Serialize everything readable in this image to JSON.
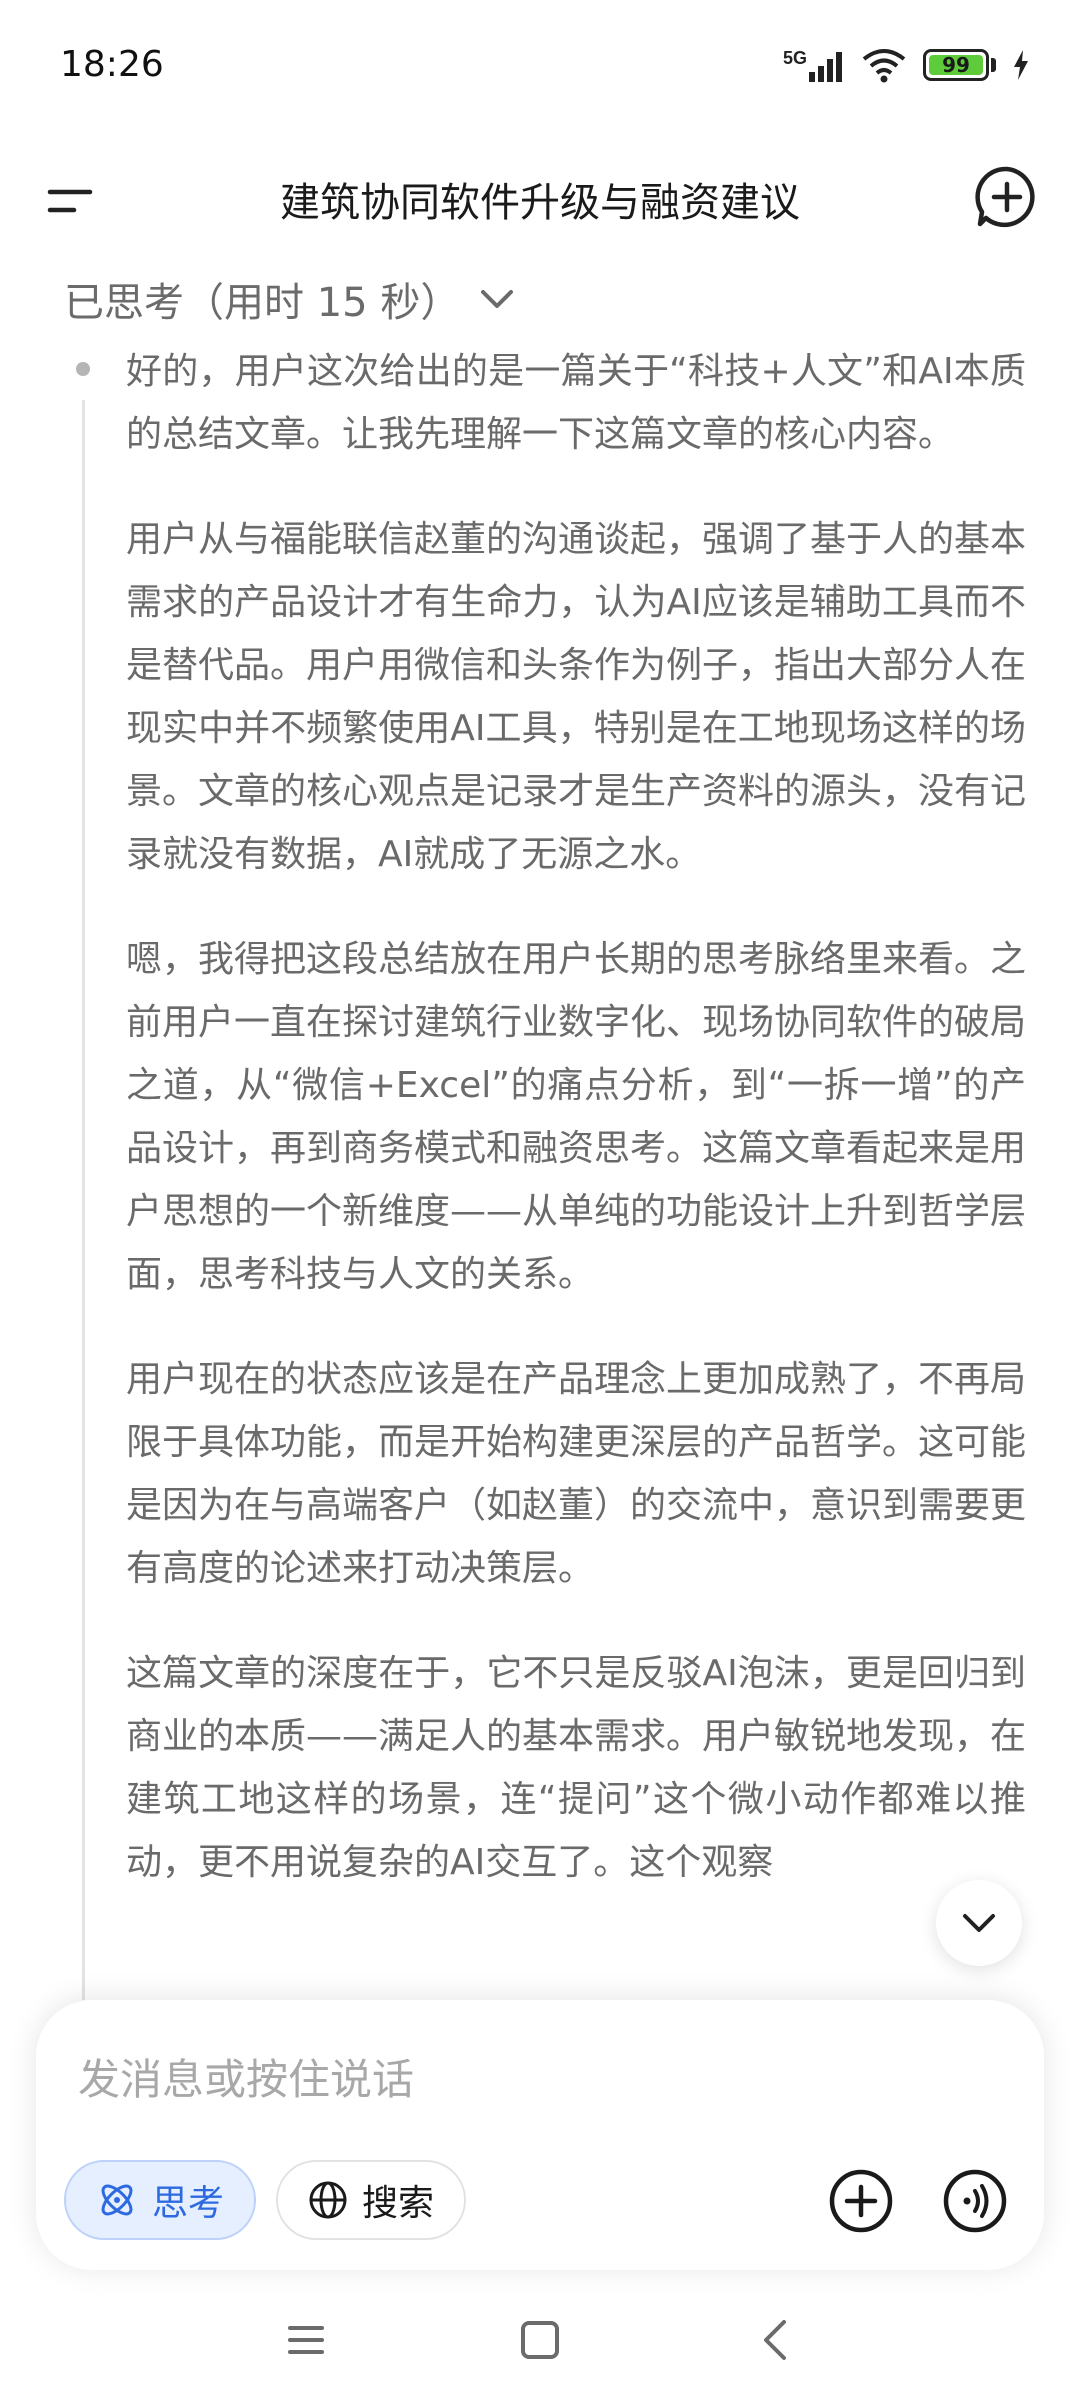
{
  "status_bar": {
    "time": "18:26",
    "network": "5G",
    "battery": "99"
  },
  "header": {
    "title": "建筑协同软件升级与融资建议"
  },
  "thinking": {
    "label": "已思考（用时 15 秒）"
  },
  "paragraphs": [
    "好的，用户这次给出的是一篇关于“科技+人文”和AI本质的总结文章。让我先理解一下这篇文章的核心内容。",
    "用户从与福能联信赵董的沟通谈起，强调了基于人的基本需求的产品设计才有生命力，认为AI应该是辅助工具而不是替代品。用户用微信和头条作为例子，指出大部分人在现实中并不频繁使用AI工具，特别是在工地现场这样的场景。文章的核心观点是记录才是生产资料的源头，没有记录就没有数据，AI就成了无源之水。",
    "嗯，我得把这段总结放在用户长期的思考脉络里来看。之前用户一直在探讨建筑行业数字化、现场协同软件的破局之道，从“微信+Excel”的痛点分析，到“一拆一增”的产品设计，再到商务模式和融资思考。这篇文章看起来是用户思想的一个新维度——从单纯的功能设计上升到哲学层面，思考科技与人文的关系。",
    "用户现在的状态应该是在产品理念上更加成熟了，不再局限于具体功能，而是开始构建更深层的产品哲学。这可能是因为在与高端客户（如赵董）的交流中，意识到需要更有高度的论述来打动决策层。",
    "这篇文章的深度在于，它不只是反驳AI泡沫，更是回归到商业的本质——满足人的基本需求。用户敏锐地发现，在建筑工地这样的场景，连“提问”这个微小动作都难以推动，更不用说复杂的AI交互了。这个观察"
  ],
  "input": {
    "placeholder": "发消息或按住说话",
    "think_label": "思考",
    "search_label": "搜索"
  },
  "colors": {
    "accent": "#2d6ae0",
    "text_secondary": "#6a6a6a",
    "battery": "#5ecb3b"
  }
}
